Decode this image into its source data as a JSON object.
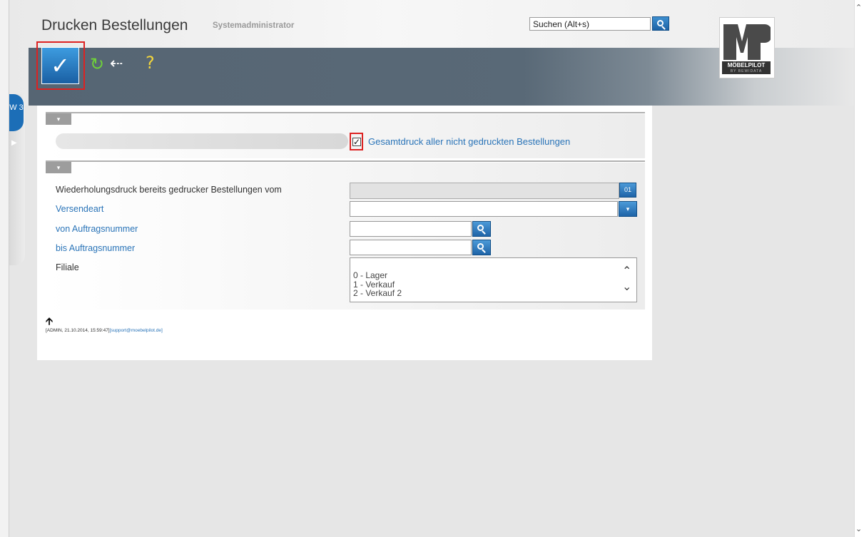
{
  "header": {
    "title": "Drucken Bestellungen",
    "user": "Systemadministrator",
    "search_placeholder": "Suchen (Alt+s)"
  },
  "logo": {
    "mark": "MP",
    "name": "MÖBELPILOT",
    "sub": "BY BEWIDATA"
  },
  "toolbar": {
    "ok_label": "✓",
    "refresh_label": "↻",
    "back_label": "⇠",
    "help_label": "?"
  },
  "side_tab": {
    "window_label": "W 3",
    "expand_label": "▶"
  },
  "section1": {
    "toggle": "▾",
    "checkbox_checked": true,
    "checkbox_mark": "✓",
    "checkbox_label": "Gesamtdruck aller nicht gedruckten Bestellungen"
  },
  "section2": {
    "toggle": "▾",
    "labels": {
      "wiederholung": "Wiederholungsdruck bereits gedrucker Bestellungen vom",
      "versendeart": "Versendeart",
      "von": "von Auftragsnummer",
      "bis": "bis Auftragsnummer",
      "filiale": "Filiale"
    },
    "date_button": "01",
    "dropdown_button": "▾",
    "filiale_options": [
      "0 - Lager",
      "1 - Verkauf",
      "2 - Verkauf 2"
    ],
    "scroll_up": "⌃",
    "scroll_down": "⌄"
  },
  "footer": {
    "up_arrow": "🡩",
    "text": "[ADMIN, 21.10.2014, 15:59:47]",
    "link": "[support@moebelpilot.de]"
  },
  "scrollbar": {
    "up": "⌃",
    "down": "⌄"
  },
  "colors": {
    "accent_blue": "#1c6eb7",
    "toolbar_gray": "#566573",
    "highlight_red": "#dd2222",
    "link_blue": "#2a74b8"
  }
}
